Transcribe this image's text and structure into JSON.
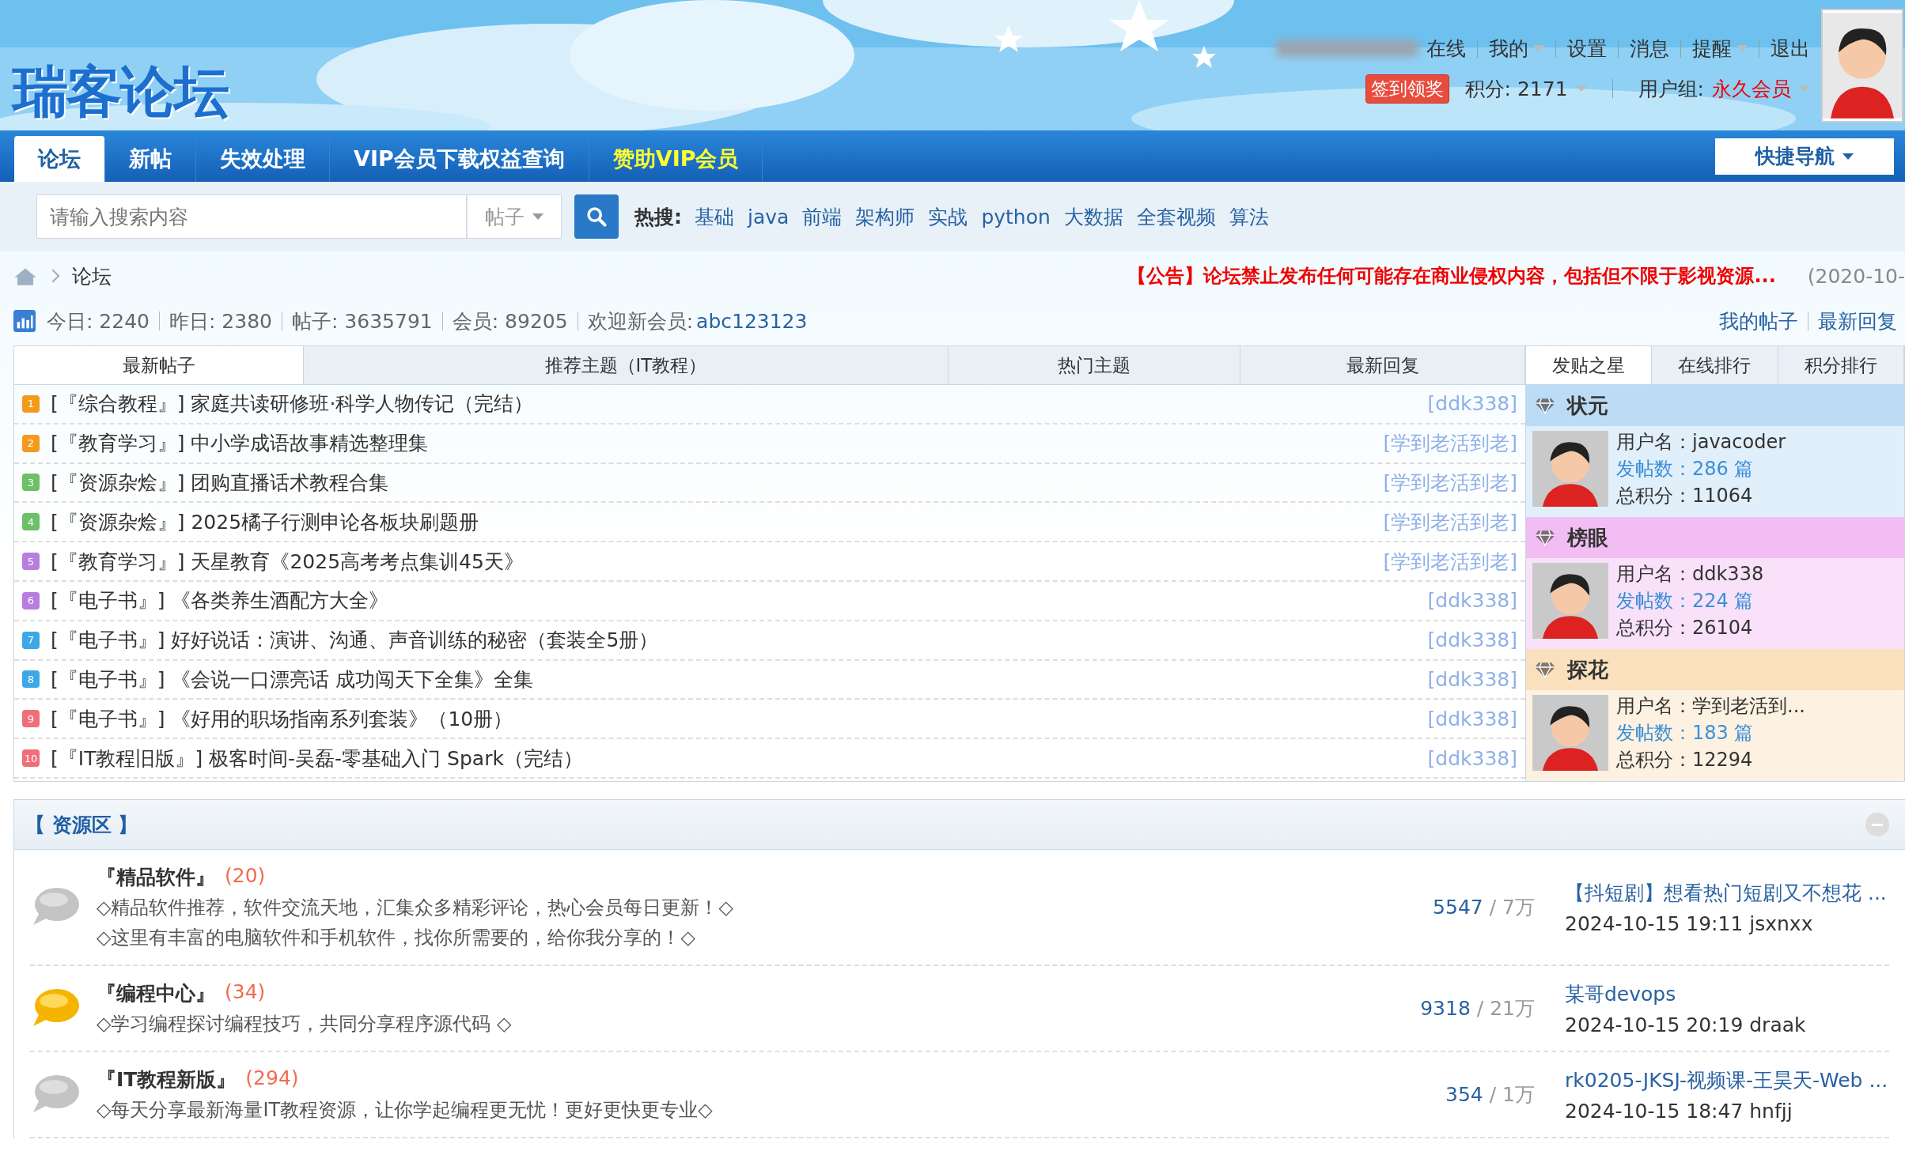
{
  "header": {
    "logo": "瑞客论坛",
    "online_text": "在线",
    "user_links": [
      {
        "label": "我的",
        "dropdown": true
      },
      {
        "label": "设置",
        "dropdown": false
      },
      {
        "label": "消息",
        "dropdown": false
      },
      {
        "label": "提醒",
        "dropdown": true
      },
      {
        "label": "退出",
        "dropdown": false
      }
    ],
    "checkin_button": "签到领奖",
    "points": "积分: 2171",
    "usergroup_label": "用户组:",
    "usergroup": "永久会员"
  },
  "nav": {
    "tabs": [
      {
        "label": "论坛",
        "selected": true,
        "highlight": false
      },
      {
        "label": "新帖",
        "selected": false,
        "highlight": false
      },
      {
        "label": "失效处理",
        "selected": false,
        "highlight": false
      },
      {
        "label": "VIP会员下载权益查询",
        "selected": false,
        "highlight": false
      },
      {
        "label": "赞助VIP会员",
        "selected": false,
        "highlight": true
      }
    ],
    "quick_nav": "快捷导航"
  },
  "search": {
    "placeholder": "请输入搜索内容",
    "scope": "帖子",
    "hot_label": "热搜:",
    "hot_terms": [
      "基础",
      "java",
      "前端",
      "架构师",
      "实战",
      "python",
      "大数据",
      "全套视频",
      "算法"
    ]
  },
  "breadcrumb": {
    "current": "论坛"
  },
  "announcement": {
    "text": "【公告】论坛禁止发布任何可能存在商业侵权内容，包括但不限于影视资源...",
    "date": "(2020-10-"
  },
  "stats": {
    "items": [
      "今日: 2240",
      "昨日: 2380",
      "帖子: 3635791",
      "会员: 89205"
    ],
    "welcome_label": "欢迎新会员:",
    "welcome_user": "abc123123",
    "links": [
      "我的帖子",
      "最新回复"
    ]
  },
  "post_tabs": [
    {
      "label": "最新帖子",
      "selected": true
    },
    {
      "label": "推荐主题（IT教程）",
      "selected": false
    },
    {
      "label": "热门主题",
      "selected": false
    },
    {
      "label": "最新回复",
      "selected": false
    }
  ],
  "posts": [
    {
      "rank": "1",
      "color": "#f39a1e",
      "title": "[『综合教程』] 家庭共读研修班·科学人物传记（完结）",
      "author": "[ddk338]"
    },
    {
      "rank": "2",
      "color": "#f39a1e",
      "title": "[『教育学习』] 中小学成语故事精选整理集",
      "author": "[学到老活到老]"
    },
    {
      "rank": "3",
      "color": "#6cc067",
      "title": "[『资源杂烩』] 团购直播话术教程合集",
      "author": "[学到老活到老]"
    },
    {
      "rank": "4",
      "color": "#6cc067",
      "title": "[『资源杂烩』] 2025橘子行测申论各板块刷题册",
      "author": "[学到老活到老]"
    },
    {
      "rank": "5",
      "color": "#b77ee0",
      "title": "[『教育学习』] 天星教育《2025高考考点集训45天》",
      "author": "[学到老活到老]"
    },
    {
      "rank": "6",
      "color": "#b77ee0",
      "title": "[『电子书』] 《各类养生酒配方大全》",
      "author": "[ddk338]"
    },
    {
      "rank": "7",
      "color": "#3ea8e6",
      "title": "[『电子书』] 好好说话：演讲、沟通、声音训练的秘密（套装全5册）",
      "author": "[ddk338]"
    },
    {
      "rank": "8",
      "color": "#3ea8e6",
      "title": "[『电子书』] 《会说一口漂亮话 成功闯天下全集》全集",
      "author": "[ddk338]"
    },
    {
      "rank": "9",
      "color": "#ee6f7a",
      "title": "[『电子书』] 《好用的职场指南系列套装》（10册）",
      "author": "[ddk338]"
    },
    {
      "rank": "10",
      "color": "#ee6f7a",
      "title": "[『IT教程旧版』] 极客时间-吴磊-零基础入门 Spark（完结）",
      "author": "[ddk338]"
    }
  ],
  "star_tabs": [
    {
      "label": "发贴之星",
      "selected": true
    },
    {
      "label": "在线排行",
      "selected": false
    },
    {
      "label": "积分排行",
      "selected": false
    }
  ],
  "stars": [
    {
      "title": "状元",
      "color": "#bcdcf6",
      "username": "用户名：javacoder",
      "posts": "发帖数：286 篇",
      "score": "总积分：11064"
    },
    {
      "title": "榜眼",
      "color": "#f2bdf2",
      "username": "用户名：ddk338",
      "posts": "发帖数：224 篇",
      "score": "总积分：26104"
    },
    {
      "title": "探花",
      "color": "#fae0bd",
      "username": "用户名：学到老活到...",
      "posts": "发帖数：183 篇",
      "score": "总积分：12294"
    }
  ],
  "section": {
    "title": "【 资源区 】",
    "expanded": true,
    "forums": [
      {
        "name": "『精品软件』",
        "count": "(20)",
        "new": false,
        "lines": [
          "◇精品软件推荐，软件交流天地，汇集众多精彩评论，热心会员每日更新！◇",
          "◇这里有丰富的电脑软件和手机软件，找你所需要的，给你我分享的！◇"
        ],
        "threads": "5547",
        "posts": "/ 7万",
        "last_title": "【抖短剧】想看热门短剧又不想花 ...",
        "last_meta": "2024-10-15 19:11 jsxnxx"
      },
      {
        "name": "『编程中心』",
        "count": "(34)",
        "new": true,
        "lines": [
          "◇学习编程探讨编程技巧，共同分享程序源代码 ◇"
        ],
        "threads": "9318",
        "posts": "/ 21万",
        "last_title": "某哥devops",
        "last_meta": "2024-10-15 20:19 draak"
      },
      {
        "name": "『IT教程新版』",
        "count": "(294)",
        "new": false,
        "lines": [
          "◇每天分享最新海量IT教程资源，让你学起编程更无忧！更好更快更专业◇"
        ],
        "threads": "354",
        "posts": "/ 1万",
        "last_title": "rk0205-JKSJ-视频课-王昊天-Web ...",
        "last_meta": "2024-10-15 18:47 hnfjj"
      }
    ]
  }
}
